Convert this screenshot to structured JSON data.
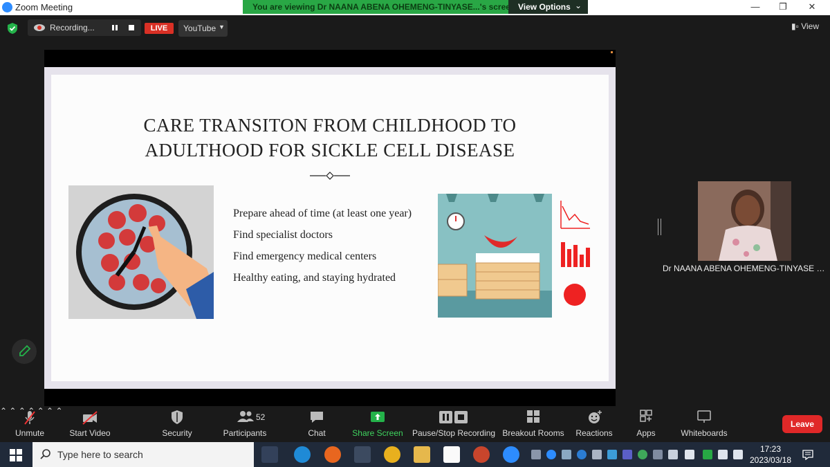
{
  "window": {
    "title": "Zoom Meeting"
  },
  "share_banner": {
    "message": "You are viewing Dr NAANA ABENA OHEMENG-TINYASE...'s screen",
    "options_label": "View Options"
  },
  "topbar": {
    "recording_label": "Recording...",
    "live_label": "LIVE",
    "stream_target": "YouTube",
    "view_label": "View"
  },
  "slide": {
    "title_line1": "CARE TRANSITON FROM CHILDHOOD TO",
    "title_line2": "ADULTHOOD FOR SICKLE CELL DISEASE",
    "bullets": [
      "Prepare ahead of  time (at least one year)",
      "Find specialist doctors",
      "Find emergency medical centers",
      "Healthy eating, and staying hydrated"
    ]
  },
  "participant": {
    "name": "Dr NAANA ABENA OHEMENG-TINYASE HE..."
  },
  "toolbar": {
    "unmute": "Unmute",
    "start_video": "Start Video",
    "security": "Security",
    "participants": "Participants",
    "participants_count": "52",
    "chat": "Chat",
    "share_screen": "Share Screen",
    "pause_stop_recording": "Pause/Stop Recording",
    "breakout_rooms": "Breakout Rooms",
    "reactions": "Reactions",
    "apps": "Apps",
    "whiteboards": "Whiteboards",
    "leave": "Leave"
  },
  "taskbar": {
    "search_placeholder": "Type here to search",
    "time": "17:23",
    "date": "2023/03/18"
  },
  "colors": {
    "share_green": "#29a745",
    "leave_red": "#e02828",
    "live_red": "#d93025",
    "taskbar": "#202a3a"
  }
}
